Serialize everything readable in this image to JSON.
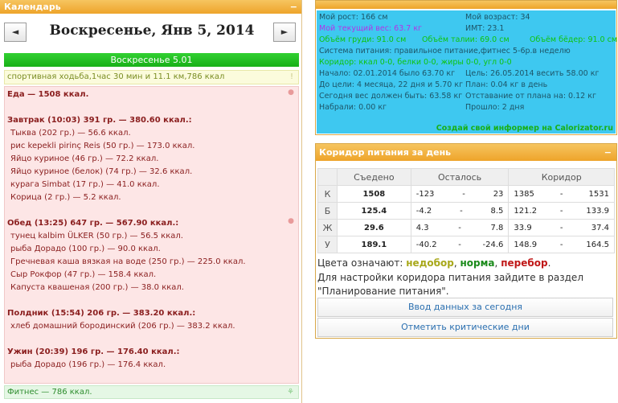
{
  "calendar": {
    "title": "Календарь",
    "collapse": "−",
    "prev": "◄",
    "next": "►",
    "date_title": "Воскресенье, Янв 5, 2014",
    "day_header": "Воскресенье 5.01",
    "activity": "спортивная ходьба,1час 30 мин и 11.1 км,786 ккал",
    "activity_mark": "!",
    "meals": [
      {
        "text": "Еда — 1508 ккал.",
        "bold": true,
        "apple": true
      },
      {
        "text": "",
        "bold": false
      },
      {
        "text": "Завтрак (10:03) 391 гр. — 380.60 ккал.:",
        "bold": true
      },
      {
        "text": "Тыква (202 гр.) — 56.6 ккал.",
        "item": true
      },
      {
        "text": "рис kepekli pirinç Reis (50 гр.) — 173.0 ккал.",
        "item": true
      },
      {
        "text": "Яйцо куриное (46 гр.) — 72.2 ккал.",
        "item": true
      },
      {
        "text": "Яйцо куриное (белок) (74 гр.) — 32.6 ккал.",
        "item": true
      },
      {
        "text": "курага Simbat (17 гр.) — 41.0 ккал.",
        "item": true
      },
      {
        "text": "Корица (2 гр.) — 5.2 ккал.",
        "item": true
      },
      {
        "text": "",
        "bold": false
      },
      {
        "text": "Обед (13:25) 647 гр. — 567.90 ккал.:",
        "bold": true,
        "apple": true
      },
      {
        "text": "тунец kalbim ÜLKER (50 гр.) — 56.5 ккал.",
        "item": true
      },
      {
        "text": "рыба Дорадо (100 гр.) — 90.0 ккал.",
        "item": true
      },
      {
        "text": "Гречневая каша вязкая на воде (250 гр.) — 225.0 ккал.",
        "item": true
      },
      {
        "text": "Сыр Рокфор (47 гр.) — 158.4 ккал.",
        "item": true
      },
      {
        "text": "Капуста квашеная (200 гр.) — 38.0 ккал.",
        "item": true
      },
      {
        "text": "",
        "bold": false
      },
      {
        "text": "Полдник (15:54) 206 гр. — 383.20 ккал.:",
        "bold": true
      },
      {
        "text": "хлеб домашний бородинский (206 гр.) — 383.2 ккал.",
        "item": true
      },
      {
        "text": "",
        "bold": false
      },
      {
        "text": "Ужин (20:39) 196 гр. — 176.40 ккал.:",
        "bold": true
      },
      {
        "text": "рыба Дорадо (196 гр.) — 176.4 ккал.",
        "item": true
      }
    ],
    "fitness": "Фитнес — 786 ккал."
  },
  "info": {
    "rows": [
      {
        "a": "Мой рост: 166 см",
        "b": "Мой возраст: 34"
      },
      {
        "a": "Мой текущий вес: 63.7 кг",
        "a_purple": true,
        "b": "ИМТ: 23.1"
      },
      {
        "a": "Объём груди: 91.0 см",
        "green": true,
        "b": "Объём талии: 69.0 см",
        "c": "Объём бёдер: 91.0 см"
      },
      {
        "a": "Система питания: правильное питание,фитнес 5-6р.в неделю"
      },
      {
        "a": "Коридор: ккал 0-0, белки 0-0, жиры 0-0, угл 0-0",
        "green": true
      },
      {
        "a": "Начало: 02.01.2014 было 63.70 кг",
        "b": "Цель: 26.05.2014 весить 58.00 кг"
      },
      {
        "a": "До цели: 4 месяца, 22 дня и 5.70 кг",
        "b": "План: 0.04 кг в день"
      },
      {
        "a": "Сегодня вес должен быть: 63.58 кг",
        "b": "Отставание от плана на: 0.12 кг"
      },
      {
        "a": "Набрали: 0.00 кг",
        "b": "Прошло: 2 дня"
      }
    ],
    "site": "Создай свой информер на Calorizator.ru"
  },
  "corridor": {
    "title": "Коридор питания за день",
    "collapse": "−",
    "headers": [
      "",
      "Съедено",
      "Осталось",
      "Коридор"
    ],
    "rows": [
      {
        "label": "К",
        "eaten": "1508",
        "eaten_class": "green-t",
        "left_min": "-123",
        "left_max": "23",
        "corr_min": "1385",
        "corr_max": "1531"
      },
      {
        "label": "Б",
        "eaten": "125.4",
        "eaten_class": "green-t",
        "left_min": "-4.2",
        "left_max": "8.5",
        "corr_min": "121.2",
        "corr_max": "133.9"
      },
      {
        "label": "Ж",
        "eaten": "29.6",
        "eaten_class": "olive-t",
        "left_min": "4.3",
        "left_max": "7.8",
        "corr_min": "33.9",
        "corr_max": "37.4"
      },
      {
        "label": "У",
        "eaten": "189.1",
        "eaten_class": "red-t",
        "left_min": "-40.2",
        "left_max": "-24.6",
        "corr_min": "148.9",
        "corr_max": "164.5"
      }
    ],
    "dash": "-",
    "legend_prefix": "Цвета означают:",
    "legend_under": "недобор",
    "legend_norm": "норма",
    "legend_over": "перебор",
    "sep": ",",
    "end": ".",
    "help": "Для настройки коридора питания зайдите в раздел \"Планирование питания\".",
    "btn_enter": "Ввод данных за сегодня",
    "btn_critical": "Отметить критические дни"
  },
  "colors": {
    "accent": "#eea42a",
    "green": "#18b018",
    "info_bg": "#3ec8f0",
    "meal_bg": "#fde6e6"
  }
}
